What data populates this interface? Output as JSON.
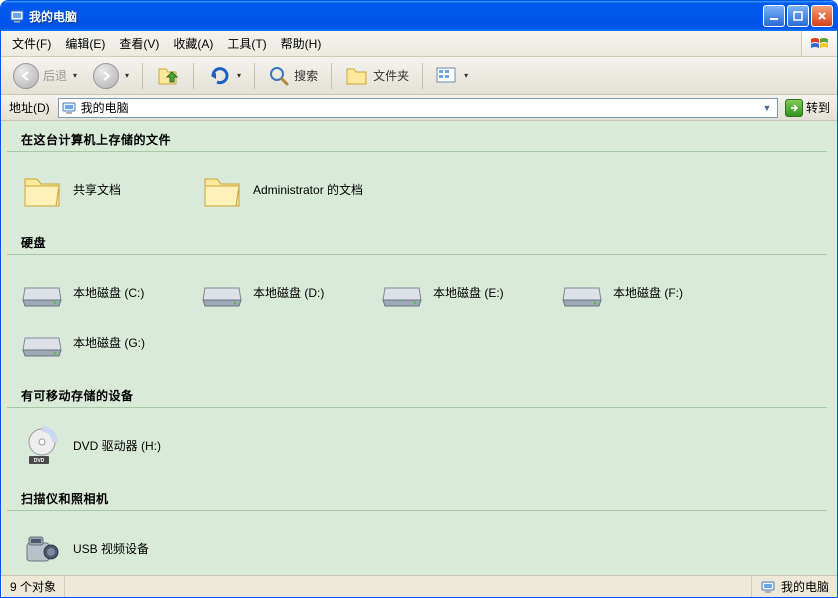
{
  "window": {
    "title": "我的电脑"
  },
  "menu": {
    "file": "文件(F)",
    "edit": "编辑(E)",
    "view": "查看(V)",
    "favorites": "收藏(A)",
    "tools": "工具(T)",
    "help": "帮助(H)"
  },
  "toolbar": {
    "back": "后退",
    "search": "搜索",
    "folders": "文件夹"
  },
  "address": {
    "label": "地址(D)",
    "value": "我的电脑",
    "go": "转到"
  },
  "sections": {
    "files_stored": "在这台计算机上存储的文件",
    "hard_drives": "硬盘",
    "removable": "有可移动存储的设备",
    "scanners": "扫描仪和照相机"
  },
  "items": {
    "shared_docs": "共享文档",
    "admin_docs": "Administrator 的文档",
    "disk_c": "本地磁盘 (C:)",
    "disk_d": "本地磁盘 (D:)",
    "disk_e": "本地磁盘 (E:)",
    "disk_f": "本地磁盘 (F:)",
    "disk_g": "本地磁盘 (G:)",
    "dvd_h": "DVD 驱动器 (H:)",
    "usb_video": "USB 视频设备"
  },
  "status": {
    "objects": "9 个对象",
    "location": "我的电脑"
  }
}
